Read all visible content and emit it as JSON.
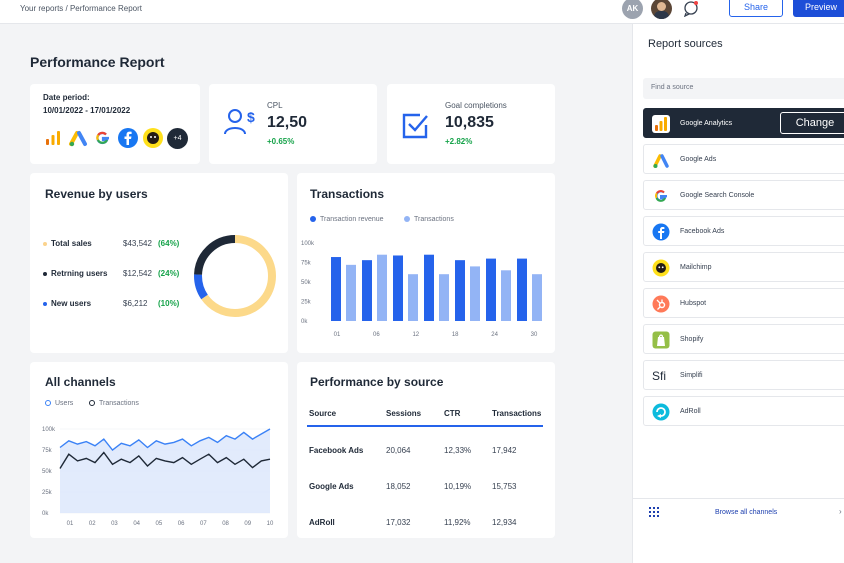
{
  "topbar": {
    "breadcrumb": "Your reports / Performance Report",
    "avatar_initials": "AK",
    "share_label": "Share",
    "preview_label": "Preview"
  },
  "page_title": "Performance Report",
  "date_card": {
    "label": "Date period:",
    "value": "10/01/2022 - 17/01/2022",
    "more_count": "+4",
    "icons": [
      "google-analytics-icon",
      "google-ads-icon",
      "google-icon",
      "facebook-icon",
      "mailchimp-icon"
    ]
  },
  "cpl_card": {
    "label": "CPL",
    "value": "12,50",
    "delta": "+0.65%"
  },
  "goal_card": {
    "label": "Goal completions",
    "value": "10,835",
    "delta": "+2.82%"
  },
  "revenue_card": {
    "title": "Revenue by users",
    "rows": [
      {
        "label": "Total sales",
        "amount": "$43,542",
        "pct": "(64%)",
        "color": "#fbd38d"
      },
      {
        "label": "Retrning users",
        "amount": "$12,542",
        "pct": "(24%)",
        "color": "#1f2937"
      },
      {
        "label": "New users",
        "amount": "$6,212",
        "pct": "(10%)",
        "color": "#2563eb"
      }
    ]
  },
  "transactions_card": {
    "title": "Transactions",
    "legend": [
      "Transaction revenue",
      "Transactions"
    ]
  },
  "channels_card": {
    "title": "All channels",
    "legend": [
      "Users",
      "Transactions"
    ]
  },
  "perf_card": {
    "title": "Performance by source",
    "headers": [
      "Source",
      "Sessions",
      "CTR",
      "Transactions"
    ],
    "rows": [
      [
        "Facebook Ads",
        "20,064",
        "12,33%",
        "17,942"
      ],
      [
        "Google Ads",
        "18,052",
        "10,19%",
        "15,753"
      ],
      [
        "AdRoll",
        "17,032",
        "11,92%",
        "12,934"
      ]
    ]
  },
  "sidebar": {
    "title": "Report sources",
    "search_placeholder": "Find a source",
    "change_label": "Change",
    "browse_label": "Browse all channels",
    "sources": [
      {
        "name": "Google Analytics",
        "icon": "google-analytics-icon"
      },
      {
        "name": "Google Ads",
        "icon": "google-ads-icon"
      },
      {
        "name": "Google Search Console",
        "icon": "google-icon"
      },
      {
        "name": "Facebook Ads",
        "icon": "facebook-icon"
      },
      {
        "name": "Mailchimp",
        "icon": "mailchimp-icon"
      },
      {
        "name": "Hubspot",
        "icon": "hubspot-icon"
      },
      {
        "name": "Shopify",
        "icon": "shopify-icon"
      },
      {
        "name": "Simplifi",
        "icon": "simplifi-icon"
      },
      {
        "name": "AdRoll",
        "icon": "adroll-icon"
      }
    ]
  },
  "chart_data": [
    {
      "type": "pie",
      "categories": [
        "Total sales",
        "Retrning users",
        "New users"
      ],
      "values": [
        64,
        24,
        10
      ],
      "colors": [
        "#fcd98a",
        "#1f2937",
        "#2563eb"
      ]
    },
    {
      "type": "bar",
      "categories": [
        "01",
        "03",
        "06",
        "09",
        "12",
        "15",
        "18",
        "21",
        "24",
        "27",
        "30"
      ],
      "tick_labels": [
        "01",
        "",
        "06",
        "",
        "12",
        "",
        "18",
        "",
        "24",
        "",
        "30"
      ],
      "y_ticks": [
        "100k",
        "75k",
        "50k",
        "25k",
        "0k"
      ],
      "ylim": [
        0,
        100
      ],
      "series": [
        {
          "name": "Transaction revenue",
          "color": "#2563eb",
          "values": [
            82,
            78,
            84,
            85,
            78,
            80,
            80
          ]
        },
        {
          "name": "Transactions",
          "color": "#93b4f5",
          "values": [
            72,
            85,
            60,
            60,
            70,
            65,
            60
          ]
        }
      ]
    },
    {
      "type": "area",
      "x_ticks": [
        "01",
        "02",
        "03",
        "04",
        "05",
        "06",
        "07",
        "08",
        "09",
        "10"
      ],
      "y_ticks": [
        "100k",
        "75k",
        "50k",
        "25k",
        "0k"
      ],
      "ylim": [
        0,
        100
      ],
      "series": [
        {
          "name": "Users",
          "color": "#3b82f6",
          "values": [
            78,
            86,
            82,
            85,
            80,
            88,
            75,
            83,
            80,
            87,
            78,
            86,
            82,
            84,
            88,
            80,
            86,
            90,
            84,
            92,
            88,
            96,
            88,
            94,
            100
          ]
        },
        {
          "name": "Transactions",
          "color": "#1f2937",
          "values": [
            53,
            70,
            62,
            65,
            60,
            72,
            58,
            64,
            60,
            68,
            56,
            65,
            62,
            60,
            66,
            58,
            64,
            70,
            60,
            66,
            58,
            64,
            54,
            62,
            64
          ]
        }
      ]
    }
  ]
}
